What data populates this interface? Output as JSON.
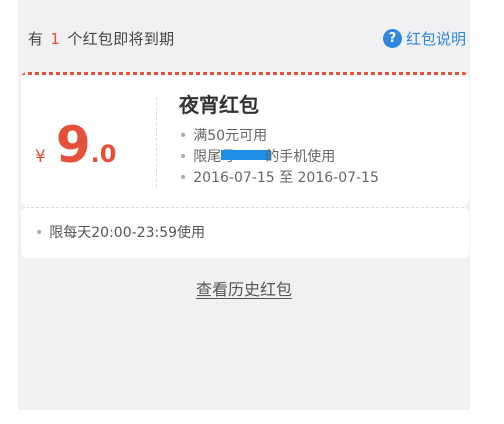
{
  "header": {
    "prefix": "有",
    "count": "1",
    "suffix": "个红包即将到期",
    "help_icon": "question-circle-icon",
    "help_glyph": "?",
    "help_label": "红包说明"
  },
  "coupon": {
    "currency": "¥",
    "amount_int": "9",
    "amount_dec": ".0",
    "title": "夜宵红包",
    "bullet": "•",
    "conditions": [
      "满50元可用",
      "2016-07-15 至 2016-07-15"
    ],
    "phone_prefix": "限尾号",
    "phone_suffix": "的手机使用",
    "time_rule": "限每天20:00-23:59使用"
  },
  "footer": {
    "history_link": "查看历史红包"
  },
  "colors": {
    "accent_red": "#e5503a",
    "link_blue": "#2e86de",
    "background": "#f1f1f3",
    "redaction_blue": "#1e8ee6"
  }
}
